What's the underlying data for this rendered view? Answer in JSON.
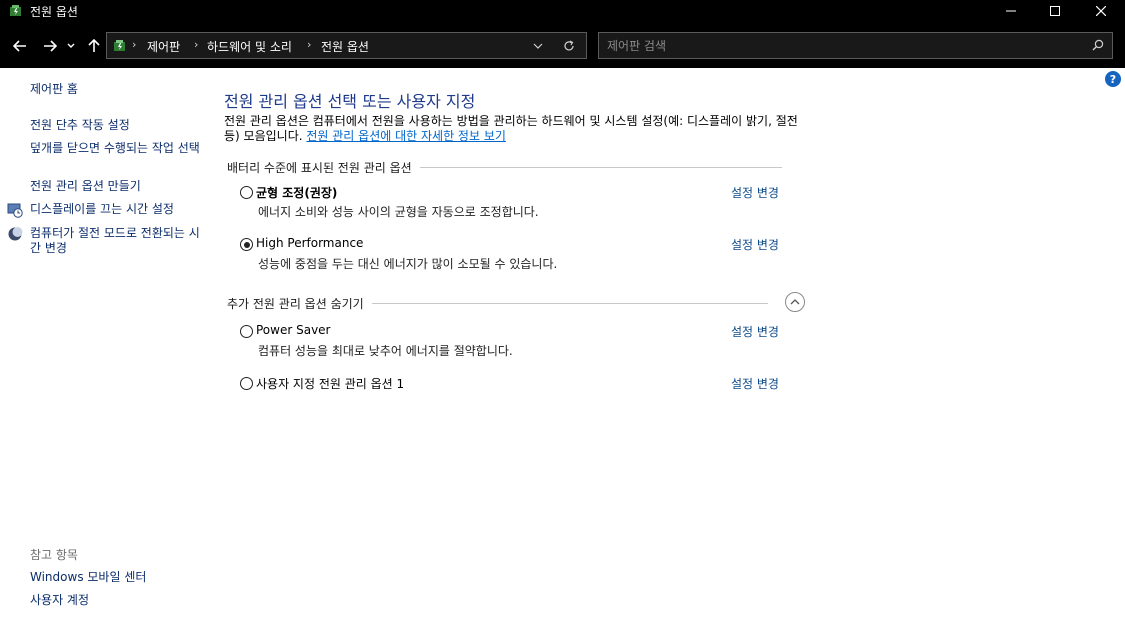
{
  "window": {
    "title": "전원 옵션",
    "minimize_icon": "minimize-icon",
    "maximize_icon": "maximize-icon",
    "close_icon": "close-icon"
  },
  "address_bar": {
    "crumbs": [
      "제어판",
      "하드웨어 및 소리",
      "전원 옵션"
    ],
    "search_placeholder": "제어판 검색"
  },
  "sidebar": {
    "home": "제어판 홈",
    "items": [
      "전원 단추 작동 설정",
      "덮개를 닫으면 수행되는 작업 선택",
      "전원 관리 옵션 만들기",
      "디스플레이를 끄는 시간 설정",
      "컴퓨터가 절전 모드로 전환되는 시간 변경"
    ],
    "see_also_heading": "참고 항목",
    "see_also": [
      "Windows 모바일 센터",
      "사용자 계정"
    ]
  },
  "main": {
    "heading": "전원 관리 옵션 선택 또는 사용자 지정",
    "description": "전원 관리 옵션은 컴퓨터에서 전원을 사용하는 방법을 관리하는 하드웨어 및 시스템 설정(예: 디스플레이 밝기, 절전 등) 모음입니다. ",
    "description_link": "전원 관리 옵션에 대한 자세한 정보 보기",
    "battery_group_heading": "배터리 수준에 표시된 전원 관리 옵션",
    "additional_group_heading": "추가 전원 관리 옵션 숨기기",
    "change_settings_label": "설정 변경",
    "plans": [
      {
        "name": "균형 조정(권장)",
        "description": "에너지 소비와 성능 사이의 균형을 자동으로 조정합니다.",
        "selected": false
      },
      {
        "name": "High Performance",
        "description": "성능에 중점을 두는 대신 에너지가 많이 소모될 수 있습니다.",
        "selected": true
      },
      {
        "name": "Power Saver",
        "description": "컴퓨터 성능을 최대로 낮추어 에너지를 절약합니다.",
        "selected": false
      },
      {
        "name": "사용자 지정 전원 관리 옵션 1",
        "description": "",
        "selected": false
      }
    ]
  }
}
